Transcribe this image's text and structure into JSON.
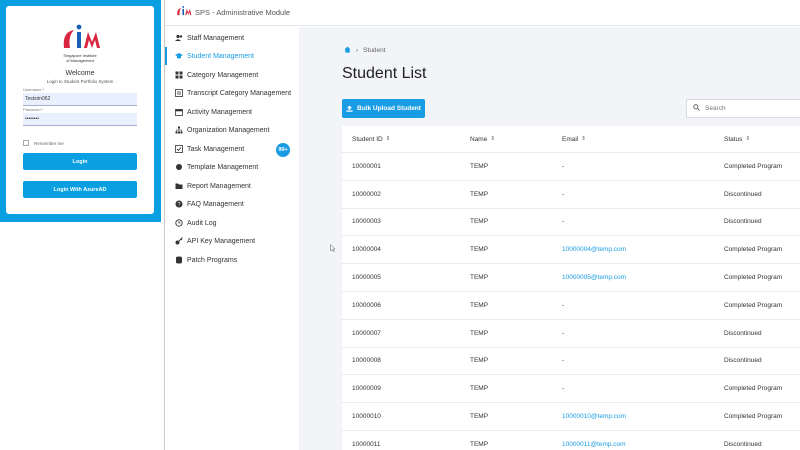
{
  "login": {
    "logo_line1": "Singapore Institute",
    "logo_line2": "of Management",
    "welcome": "Welcome",
    "subtitle": "Login to Student Portfolio System",
    "username_label": "Username *",
    "username_value": "Testsim062",
    "password_label": "Password *",
    "password_value": "••••••••",
    "remember_label": "Remember me",
    "login_button": "Login",
    "azure_button": "Login With AzureAD"
  },
  "header": {
    "title": "SPS - Administrative Module"
  },
  "sidebar": {
    "items": [
      {
        "label": "Staff Management",
        "icon": "users-icon"
      },
      {
        "label": "Student Management",
        "icon": "graduation-cap-icon"
      },
      {
        "label": "Category Management",
        "icon": "grid-icon"
      },
      {
        "label": "Transcript Category Management",
        "icon": "list-icon"
      },
      {
        "label": "Activity Management",
        "icon": "calendar-icon"
      },
      {
        "label": "Organization Management",
        "icon": "sitemap-icon"
      },
      {
        "label": "Task Management",
        "icon": "tasks-icon"
      },
      {
        "label": "Template Management",
        "icon": "template-icon"
      },
      {
        "label": "Report Management",
        "icon": "folder-icon"
      },
      {
        "label": "FAQ Management",
        "icon": "question-icon"
      },
      {
        "label": "Audit Log",
        "icon": "clock-icon"
      },
      {
        "label": "API Key Management",
        "icon": "key-icon"
      },
      {
        "label": "Patch Programs",
        "icon": "database-icon"
      }
    ],
    "task_badge": "99+"
  },
  "main": {
    "breadcrumb": "Student",
    "title": "Student List",
    "bulk_upload_label": "Bulk Upload Student",
    "search_placeholder": "Search",
    "columns": [
      "Student ID",
      "Name",
      "Email",
      "Status"
    ],
    "rows": [
      {
        "id": "10000001",
        "name": "TEMP",
        "email": "-",
        "status": "Completed Program"
      },
      {
        "id": "10000002",
        "name": "TEMP",
        "email": "-",
        "status": "Discontinued"
      },
      {
        "id": "10000003",
        "name": "TEMP",
        "email": "-",
        "status": "Discontinued"
      },
      {
        "id": "10000004",
        "name": "TEMP",
        "email": "10000004@temp.com",
        "status": "Completed Program"
      },
      {
        "id": "10000005",
        "name": "TEMP",
        "email": "10000005@temp.com",
        "status": "Completed Program"
      },
      {
        "id": "10000006",
        "name": "TEMP",
        "email": "-",
        "status": "Completed Program"
      },
      {
        "id": "10000007",
        "name": "TEMP",
        "email": "-",
        "status": "Discontinued"
      },
      {
        "id": "10000008",
        "name": "TEMP",
        "email": "-",
        "status": "Discontinued"
      },
      {
        "id": "10000009",
        "name": "TEMP",
        "email": "-",
        "status": "Completed Program"
      },
      {
        "id": "10000010",
        "name": "TEMP",
        "email": "10000010@temp.com",
        "status": "Completed Program"
      },
      {
        "id": "10000011",
        "name": "TEMP",
        "email": "10000011@temp.com",
        "status": "Discontinued"
      }
    ]
  },
  "colors": {
    "accent": "#1a9ce4",
    "login_bg": "#0a9fe0",
    "main_bg": "#f2f4f8"
  }
}
